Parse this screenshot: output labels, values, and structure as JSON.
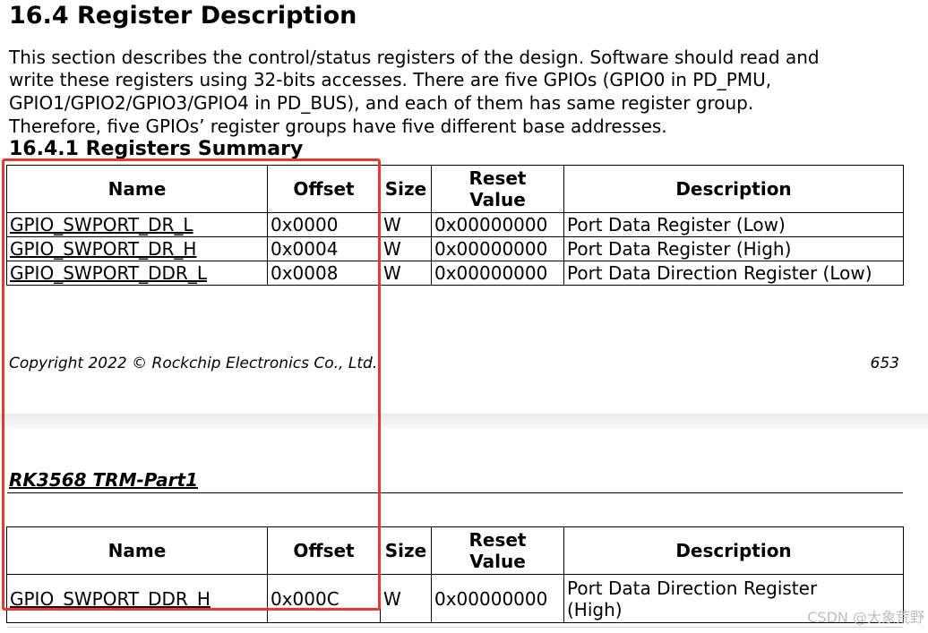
{
  "section": {
    "title": "16.4 Register Description",
    "paragraph_lines": [
      "This section describes the control/status registers of the design. Software should read and",
      "write these registers using 32-bits accesses. There are five GPIOs (GPIO0 in PD_PMU,",
      "GPIO1/GPIO2/GPIO3/GPIO4 in PD_BUS), and each of them has same register group.",
      "Therefore, five GPIOs’ register groups have five different base addresses."
    ],
    "subsection_title": "16.4.1 Registers Summary"
  },
  "table_headers": {
    "name": "Name",
    "offset": "Offset",
    "size": "Size",
    "reset_line1": "Reset",
    "reset_line2": "Value",
    "description": "Description"
  },
  "table1_rows": [
    {
      "name": "GPIO_SWPORT_DR_L",
      "offset": "0x0000",
      "size": "W",
      "reset": "0x00000000",
      "description": "Port Data Register (Low)"
    },
    {
      "name": "GPIO_SWPORT_DR_H",
      "offset": "0x0004",
      "size": "W",
      "reset": "0x00000000",
      "description": "Port Data Register (High)"
    },
    {
      "name": "GPIO_SWPORT_DDR_L",
      "offset": "0x0008",
      "size": "W",
      "reset": "0x00000000",
      "description": "Port Data Direction Register (Low)"
    }
  ],
  "footer": {
    "copyright": "Copyright 2022 © Rockchip Electronics Co., Ltd.",
    "page_number": "653"
  },
  "next_page": {
    "doc_header": "RK3568 TRM-Part1"
  },
  "table2_rows": [
    {
      "name": "GPIO_SWPORT_DDR_H",
      "offset": "0x000C",
      "size": "W",
      "reset": "0x00000000",
      "description_line1": "Port Data Direction Register",
      "description_line2": "(High)"
    }
  ],
  "watermark": "CSDN @大象荒野",
  "colors": {
    "highlight_box": "#e53935",
    "text": "#000000",
    "background": "#ffffff"
  }
}
